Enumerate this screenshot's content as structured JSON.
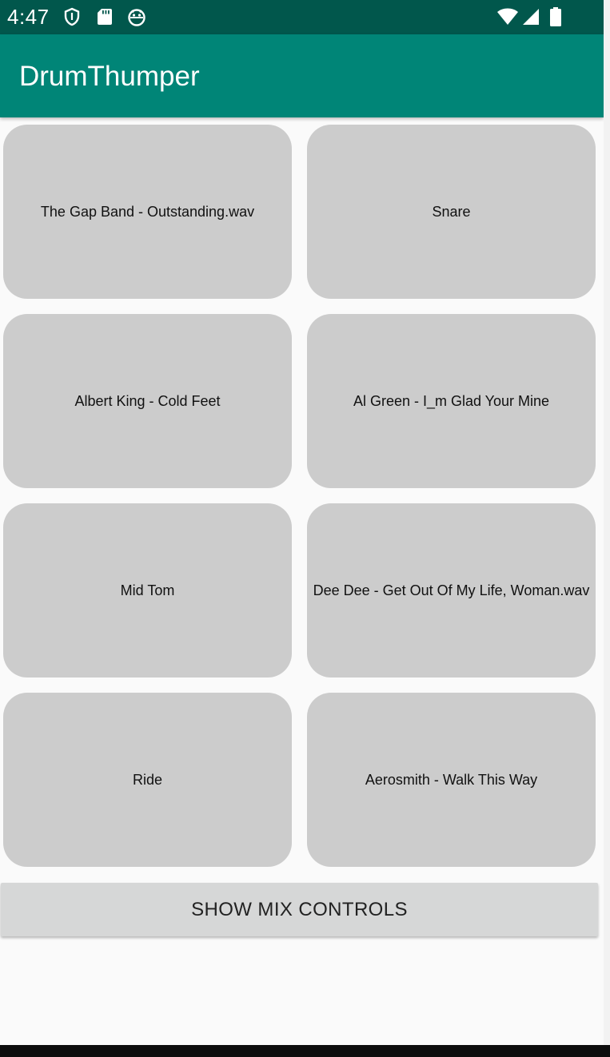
{
  "status_bar": {
    "time": "4:47",
    "left_icons": [
      "shield-icon",
      "sd-card-icon",
      "android-head-icon"
    ],
    "right_icons": [
      "wifi-icon",
      "signal-icon",
      "battery-icon"
    ]
  },
  "app_bar": {
    "title": "DrumThumper",
    "color": "#008577",
    "status_color": "#01574c"
  },
  "pads": [
    {
      "label": "The Gap Band - Outstanding.wav"
    },
    {
      "label": "Snare"
    },
    {
      "label": "Albert King - Cold Feet"
    },
    {
      "label": "Al Green - I_m Glad Your Mine"
    },
    {
      "label": "Mid Tom"
    },
    {
      "label": "Dee Dee - Get Out Of My Life, Woman.wav"
    },
    {
      "label": "Ride"
    },
    {
      "label": "Aerosmith - Walk This Way"
    }
  ],
  "mix_button": {
    "label": "SHOW MIX CONTROLS"
  },
  "colors": {
    "pad": "#cccccc",
    "background": "#fafafa",
    "button": "#d6d7d7"
  }
}
